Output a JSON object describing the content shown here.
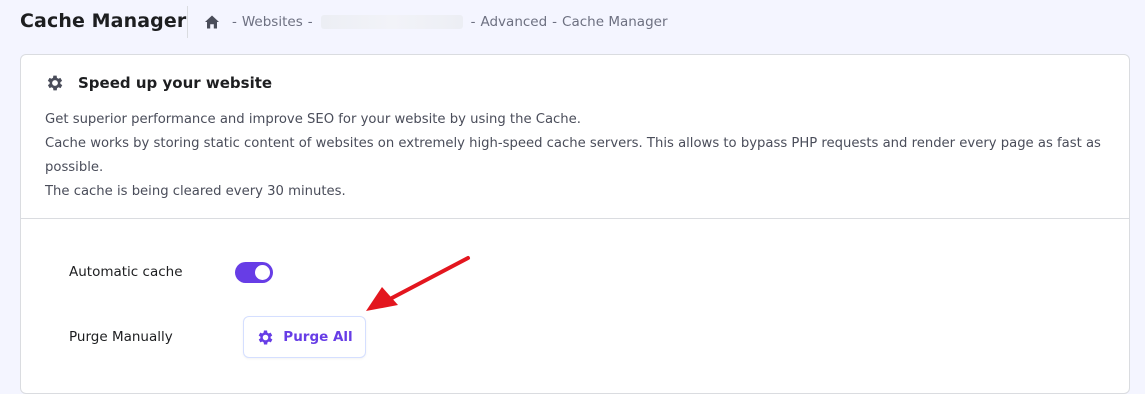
{
  "header": {
    "title": "Cache Manager",
    "breadcrumb": {
      "home_icon": "home-icon",
      "items": [
        "Websites",
        "Advanced",
        "Cache Manager"
      ],
      "separator": "-"
    }
  },
  "card": {
    "icon": "gear-icon",
    "title": "Speed up your website",
    "description": [
      "Get superior performance and improve SEO for your website by using the Cache.",
      "Cache works by storing static content of websites on extremely high-speed cache servers. This allows to bypass PHP requests and render every page as fast as possible.",
      "The cache is being cleared every 30 minutes."
    ]
  },
  "settings": {
    "automatic_cache": {
      "label": "Automatic cache",
      "enabled": true
    },
    "purge": {
      "label": "Purge Manually",
      "button_label": "Purge All",
      "button_icon": "gear-icon"
    }
  },
  "annotation": {
    "arrow_icon": "red-arrow-icon",
    "color": "#e3161e"
  },
  "colors": {
    "accent": "#673de6",
    "text_dark": "#1d1e20",
    "text_muted": "#6d7081",
    "background": "#f4f5ff"
  }
}
